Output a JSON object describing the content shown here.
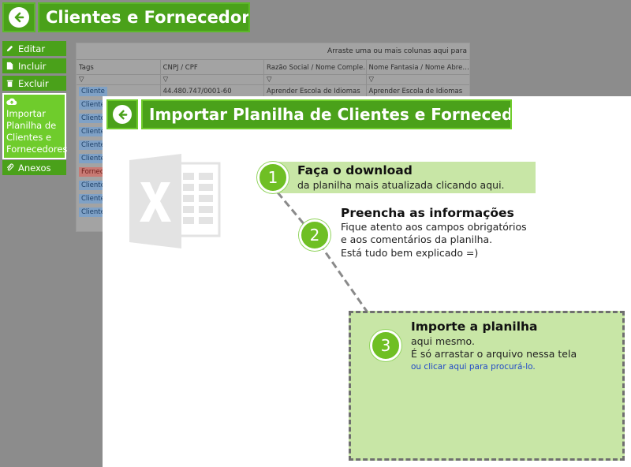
{
  "app": {
    "title": "Clientes e Fornecedores"
  },
  "sidebar": {
    "items": [
      {
        "label": "Editar",
        "icon": "pencil-icon"
      },
      {
        "label": "Incluir",
        "icon": "file-icon"
      },
      {
        "label": "Excluir",
        "icon": "trash-icon"
      },
      {
        "label": "Importar Planilha de Clientes e Fornecedores",
        "icon": "cloud-upload-icon"
      },
      {
        "label": "Anexos",
        "icon": "paperclip-icon"
      }
    ]
  },
  "grid": {
    "drop_hint": "Arraste uma ou mais colunas aqui para",
    "columns": [
      "Tags",
      "CNPJ / CPF",
      "Razão Social / Nome Comple…",
      "Nome Fantasia / Nome Abre…"
    ],
    "filter_glyph": "▽",
    "rows": [
      {
        "tag": "Cliente",
        "tag_type": "cliente",
        "cnpj": "44.480.747/0001-60",
        "razao": "Aprender Escola de Idiomas",
        "fantasia": "Aprender Escola de Idiomas"
      },
      {
        "tag": "Cliente",
        "tag_type": "cliente"
      },
      {
        "tag": "Cliente",
        "tag_type": "cliente"
      },
      {
        "tag": "Cliente",
        "tag_type": "cliente"
      },
      {
        "tag": "Cliente",
        "tag_type": "cliente"
      },
      {
        "tag": "Cliente",
        "tag_type": "cliente"
      },
      {
        "tag": "Fornecedor",
        "tag_type": "fornecedor"
      },
      {
        "tag": "Cliente",
        "tag_type": "cliente"
      },
      {
        "tag": "Cliente",
        "tag_type": "cliente"
      },
      {
        "tag": "Cliente",
        "tag_type": "cliente"
      }
    ]
  },
  "modal": {
    "title": "Importar Planilha de Clientes e Forneced…",
    "steps": [
      {
        "number": "1",
        "title": "Faça o download",
        "lines": [
          "da planilha mais atualizada clicando aqui."
        ]
      },
      {
        "number": "2",
        "title": "Preencha as informações",
        "lines": [
          "Fique atento aos campos obrigatórios",
          "e aos comentários da planilha.",
          "Está tudo bem explicado =)"
        ]
      },
      {
        "number": "3",
        "title": "Importe a planilha",
        "lines": [
          "aqui mesmo.",
          "É só arrastar o arquivo nessa tela"
        ],
        "link": "ou clicar aqui para procurá-lo."
      }
    ]
  },
  "colors": {
    "green": "#4aa11a",
    "light_green": "#c8e6a6",
    "badge_green": "#6fbf24",
    "link_blue": "#2149c8"
  }
}
